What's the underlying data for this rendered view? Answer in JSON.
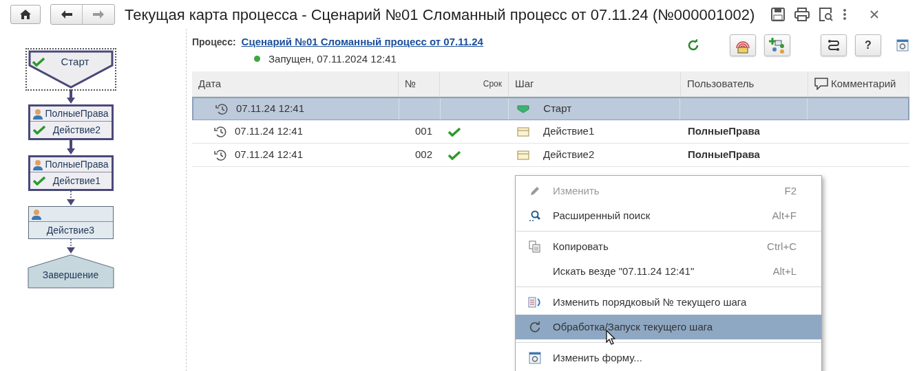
{
  "window": {
    "title": "Текущая карта процесса - Сценарий №01 Сломанный процесс от 07.11.24 (№000001002)"
  },
  "diagram": {
    "nodes": [
      {
        "kind": "start",
        "label": "Старт",
        "done": true,
        "selected": true
      },
      {
        "kind": "action",
        "user": "ПолныеПрава",
        "label": "Действие2",
        "done": true,
        "passed": true
      },
      {
        "kind": "action",
        "user": "ПолныеПрава",
        "label": "Действие1",
        "done": true,
        "passed": true
      },
      {
        "kind": "action",
        "label": "Действие3",
        "done": false,
        "passed": false
      },
      {
        "kind": "end",
        "label": "Завершение",
        "passed": false
      }
    ]
  },
  "process": {
    "label": "Процесс:",
    "link": "Сценарий №01 Сломанный процесс от 07.11.24",
    "status": "Запущен, 07.11.2024 12:41",
    "color": "#3ea83e"
  },
  "help_button": "?",
  "table": {
    "columns": [
      {
        "label": "Дата"
      },
      {
        "label": "№"
      },
      {
        "label": "Срок",
        "kind": "small"
      },
      {
        "label": "Шаг"
      },
      {
        "label": "Пользователь"
      },
      {
        "label": "Комментарий",
        "kind": "comment"
      }
    ],
    "rows": [
      {
        "date": "07.11.24 12:41",
        "step": "Старт",
        "kind": "start",
        "done": false,
        "selected": true
      },
      {
        "date": "07.11.24 12:41",
        "number": "001",
        "step": "Действие1",
        "kind": "action",
        "user": "ПолныеПрава",
        "done": true,
        "selected": false
      },
      {
        "date": "07.11.24 12:41",
        "number": "002",
        "step": "Действие2",
        "kind": "action",
        "user": "ПолныеПрава",
        "done": true,
        "selected": false
      }
    ]
  },
  "context_menu": [
    {
      "kind": "pencil",
      "label": "Изменить",
      "shortcut": "F2",
      "disabled": true,
      "selected": false
    },
    {
      "kind": "search",
      "label": "Расширенный поиск",
      "shortcut": "Alt+F",
      "disabled": false,
      "selected": false
    },
    {
      "kind": "copy",
      "label": "Копировать",
      "shortcut": "Ctrl+C",
      "disabled": false,
      "selected": false,
      "separator": true
    },
    {
      "label": "Искать везде \"07.11.24 12:41\"",
      "shortcut": "Alt+L",
      "disabled": false,
      "selected": false
    },
    {
      "kind": "renumber",
      "label": "Изменить порядковый № текущего шага",
      "disabled": false,
      "selected": false,
      "separator": true
    },
    {
      "kind": "refresh",
      "label": "Обработка/Запуск текущего шага",
      "disabled": false,
      "selected": true
    },
    {
      "kind": "form",
      "label": "Изменить форму...",
      "disabled": false,
      "selected": false,
      "separator": true
    }
  ]
}
